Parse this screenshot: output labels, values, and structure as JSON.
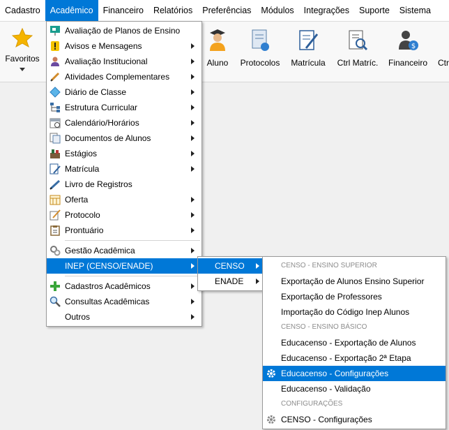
{
  "menubar": {
    "items": [
      {
        "label": "Cadastro"
      },
      {
        "label": "Acadêmico"
      },
      {
        "label": "Financeiro"
      },
      {
        "label": "Relatórios"
      },
      {
        "label": "Preferências"
      },
      {
        "label": "Módulos"
      },
      {
        "label": "Integrações"
      },
      {
        "label": "Suporte"
      },
      {
        "label": "Sistema"
      }
    ]
  },
  "toolbar": {
    "favoritos": "Favoritos",
    "aluno": "Aluno",
    "protocolos": "Protocolos",
    "matricula": "Matrícula",
    "ctrl_matric": "Ctrl Matríc.",
    "financeiro": "Financeiro",
    "ctrl_partial": "Ctr"
  },
  "academico_menu": {
    "items": [
      {
        "label": "Avaliação de Planos de Ensino",
        "icon": "presentation-board-icon"
      },
      {
        "label": "Avisos e Mensagens",
        "icon": "warning-icon"
      },
      {
        "label": "Avaliação Institucional",
        "icon": "person-icon"
      },
      {
        "label": "Atividades Complementares",
        "icon": "pencil-icon"
      },
      {
        "label": "Diário de Classe",
        "icon": "diamond-icon"
      },
      {
        "label": "Estrutura Curricular",
        "icon": "hierarchy-icon"
      },
      {
        "label": "Calendário/Horários",
        "icon": "calendar-icon"
      },
      {
        "label": "Documentos de Alunos",
        "icon": "documents-icon"
      },
      {
        "label": "Estágios",
        "icon": "tools-icon"
      },
      {
        "label": "Matrícula",
        "icon": "edit-form-icon"
      },
      {
        "label": "Livro de Registros",
        "icon": "pen-icon"
      },
      {
        "label": "Oferta",
        "icon": "grid-calendar-icon"
      },
      {
        "label": "Protocolo",
        "icon": "pen-paper-icon"
      },
      {
        "label": "Prontuário",
        "icon": "clipboard-icon"
      },
      {
        "label": "Gestão Acadêmica",
        "icon": "gears-icon"
      },
      {
        "label": "INEP (CENSO/ENADE)",
        "icon": ""
      },
      {
        "label": "Cadastros Acadêmicos",
        "icon": "green-plus-icon"
      },
      {
        "label": "Consultas Acadêmicas",
        "icon": "magnifier-icon"
      },
      {
        "label": "Outros",
        "icon": ""
      }
    ]
  },
  "inep_menu": {
    "items": [
      {
        "label": "CENSO"
      },
      {
        "label": "ENADE"
      }
    ]
  },
  "censo_menu": {
    "header_superior": "CENSO - ENSINO SUPERIOR",
    "header_basico": "CENSO - ENSINO BÁSICO",
    "header_config": "CONFIGURAÇÕES",
    "items": [
      {
        "label": "Exportação de Alunos Ensino Superior"
      },
      {
        "label": "Exportação de Professores"
      },
      {
        "label": "Importação do Código Inep Alunos"
      },
      {
        "label": "Educacenso - Exportação de Alunos"
      },
      {
        "label": "Educacenso - Exportação 2ª Etapa"
      },
      {
        "label": "Educacenso - Configurações"
      },
      {
        "label": "Educacenso - Validação"
      },
      {
        "label": "CENSO - Configurações"
      }
    ]
  },
  "colors": {
    "accent": "#0078d7"
  }
}
